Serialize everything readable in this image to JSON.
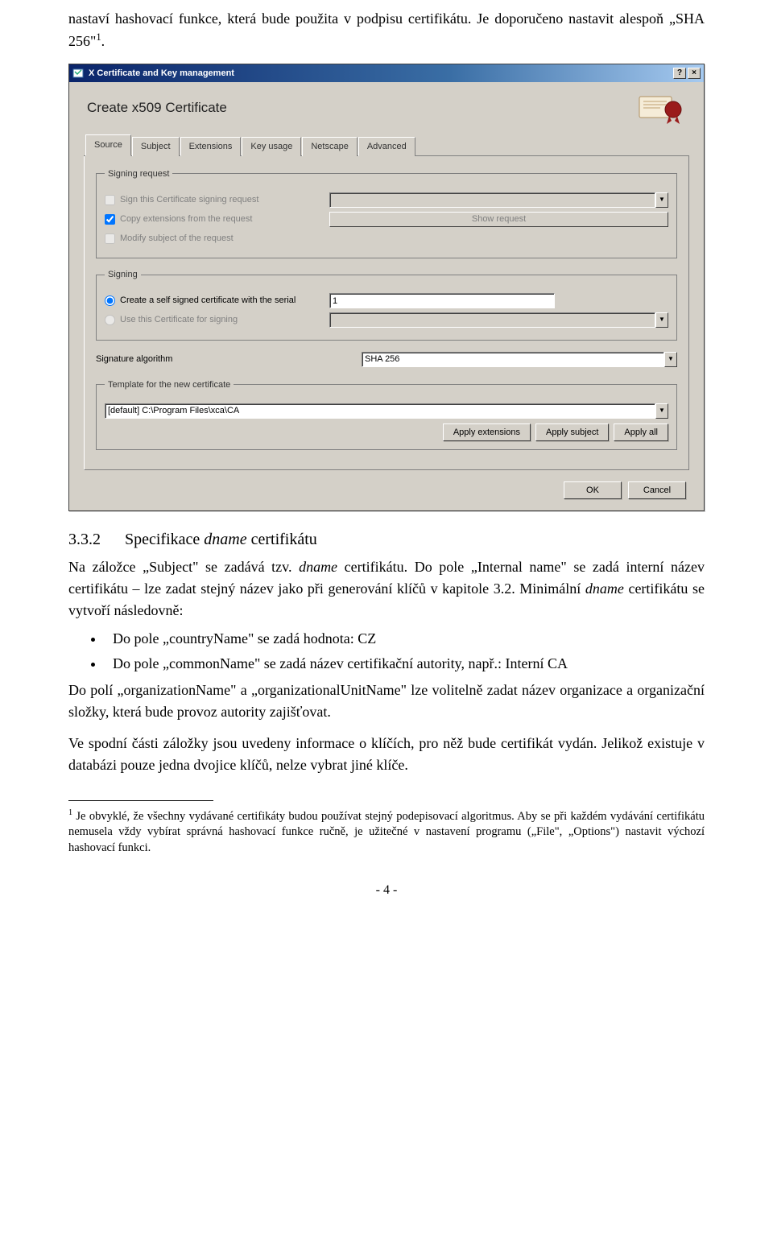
{
  "para1": "nastaví hashovací funkce, která bude použita v podpisu certifikátu. Je doporučeno nastavit alespoň „SHA 256\"",
  "para1_sup": "1",
  "para1_end": ".",
  "screenshot": {
    "window_title": "X Certificate and Key management",
    "dialog_title": "Create x509 Certificate",
    "tabs": [
      "Source",
      "Subject",
      "Extensions",
      "Key usage",
      "Netscape",
      "Advanced"
    ],
    "group_signing_request": {
      "legend": "Signing request",
      "opt_sign_csr": "Sign this Certificate signing request",
      "opt_copy_ext": "Copy extensions from the request",
      "opt_modify_subj": "Modify subject of the request",
      "show_request_btn": "Show request"
    },
    "group_signing": {
      "legend": "Signing",
      "opt_self_signed": "Create a self signed certificate with the serial",
      "serial_value": "1",
      "opt_use_cert": "Use this Certificate for signing"
    },
    "sig_alg_label": "Signature algorithm",
    "sig_alg_value": "SHA 256",
    "group_template": {
      "legend": "Template for the new certificate",
      "value": "[default] C:\\Program Files\\xca\\CA",
      "btn_apply_ext": "Apply extensions",
      "btn_apply_subj": "Apply subject",
      "btn_apply_all": "Apply all"
    },
    "btn_ok": "OK",
    "btn_cancel": "Cancel"
  },
  "heading_num": "3.3.2",
  "heading_text_pre": "Specifikace ",
  "heading_text_em": "dname",
  "heading_text_post": " certifikátu",
  "para2a": "Na záložce „Subject\" se zadává tzv. ",
  "para2em": "dname",
  "para2b": " certifikátu. Do pole „Internal name\" se zadá interní název certifikátu – lze zadat stejný název jako při generování klíčů v kapitole 3.2. Minimální ",
  "para2em2": "dname",
  "para2c": " certifikátu se vytvoří následovně:",
  "bul1": "Do pole „countryName\" se zadá hodnota: CZ",
  "bul2": "Do pole „commonName\" se zadá název certifikační autority, např.: Interní CA",
  "para3": "Do polí „organizationName\" a „organizationalUnitName\" lze volitelně zadat název organizace a organizační složky, která bude provoz autority zajišťovat.",
  "para4": "Ve spodní části záložky jsou uvedeny informace o klíčích, pro něž bude certifikát vydán. Jelikož existuje v databázi pouze jedna dvojice klíčů, nelze vybrat jiné klíče.",
  "footnote_sup": "1",
  "footnote": " Je obvyklé, že všechny vydávané certifikáty budou používat stejný podepisovací algoritmus. Aby se při každém vydávání certifikátu nemusela vždy vybírat správná hashovací funkce ručně, je užitečné v nastavení programu („File\", „Options\") nastavit výchozí hashovací funkci.",
  "page_num": "- 4 -"
}
